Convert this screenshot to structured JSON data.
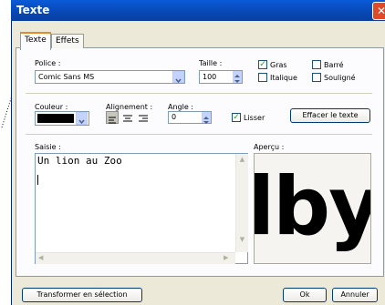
{
  "window": {
    "title": "Texte",
    "close_glyph": "✕"
  },
  "tabs": [
    {
      "label": "Texte"
    },
    {
      "label": "Effets"
    }
  ],
  "font": {
    "label": "Police :",
    "value": "Comic Sans MS"
  },
  "size": {
    "label": "Taille :",
    "value": "100"
  },
  "styles": {
    "bold": {
      "label": "Gras",
      "checked": true
    },
    "italic": {
      "label": "Italique",
      "checked": false
    },
    "strike": {
      "label": "Barré",
      "checked": false
    },
    "underline": {
      "label": "Souligné",
      "checked": false
    }
  },
  "color": {
    "label": "Couleur :",
    "value": "#000000"
  },
  "alignment": {
    "label": "Alignement :"
  },
  "angle": {
    "label": "Angle :",
    "value": "0"
  },
  "smooth": {
    "label": "Lisser",
    "checked": true
  },
  "clear_button": "Effacer le texte",
  "input": {
    "label": "Saisie :",
    "value": "Un lion au Zoo"
  },
  "preview": {
    "label": "Aperçu :",
    "text": "lby"
  },
  "buttons": {
    "transform": "Transformer en sélection",
    "ok": "Ok",
    "cancel": "Annuler"
  }
}
